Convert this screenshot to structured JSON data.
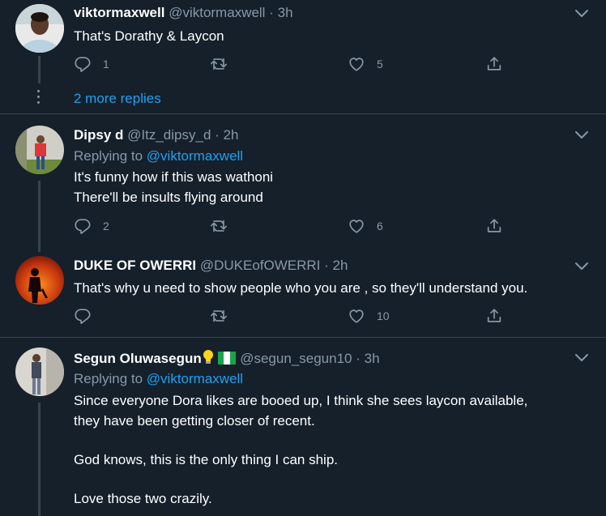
{
  "tweets": [
    {
      "name": "viktormaxwell",
      "handle": "@viktormaxwell",
      "dot": "·",
      "time": "3h",
      "lines": [
        "That's Dorathy & Laycon"
      ],
      "replies": "1",
      "retweets": "",
      "likes": "5"
    },
    {
      "name": "Dipsy d",
      "handle": "@Itz_dipsy_d",
      "dot": "·",
      "time": "2h",
      "replying_label": "Replying to",
      "replying_to": "@viktormaxwell",
      "lines": [
        "It's funny how if this was wathoni",
        "There'll be insults flying around"
      ],
      "replies": "2",
      "retweets": "",
      "likes": "6"
    },
    {
      "name": "DUKE OF OWERRI",
      "handle": "@DUKEofOWERRI",
      "dot": "·",
      "time": "2h",
      "lines": [
        "That's why u need to show people who you are , so they'll understand you."
      ],
      "replies": "",
      "retweets": "",
      "likes": "10"
    },
    {
      "name": "Segun Oluwasegun",
      "handle": "@segun_segun10",
      "dot": "·",
      "time": "3h",
      "replying_label": "Replying to",
      "replying_to": "@viktormaxwell",
      "lines": [
        "Since everyone Dora likes are booed up, I think she sees laycon available,",
        "they have been getting closer of recent.",
        "",
        "God knows, this is the only thing I can ship.",
        "",
        "Love those two crazily."
      ]
    }
  ],
  "more_replies": "2 more replies",
  "colors": {
    "background": "#15202b",
    "text": "#ffffff",
    "muted": "#8899a6",
    "accent": "#1da1f2",
    "border": "#38444d"
  },
  "icons": [
    "reply-icon",
    "retweet-icon",
    "like-icon",
    "share-icon",
    "chevron-down-icon",
    "bulb-emoji",
    "nigeria-flag-emoji"
  ]
}
